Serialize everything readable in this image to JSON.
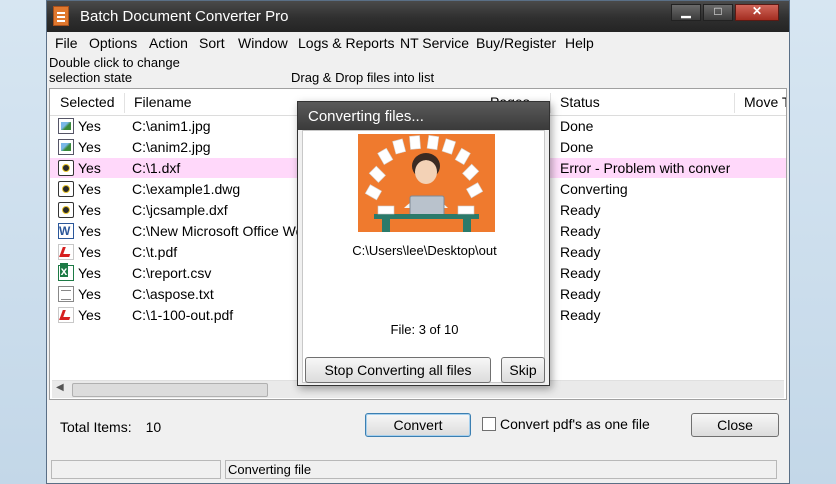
{
  "window": {
    "title": "Batch Document Converter Pro",
    "min_glyph": "▁",
    "max_glyph": "□",
    "close_glyph": "✕"
  },
  "menu": [
    "File",
    "Options",
    "Action",
    "Sort",
    "Window",
    "Logs & Reports",
    "NT Service",
    "Buy/Register",
    "Help"
  ],
  "hints": {
    "selection": [
      "Double click to change",
      "selection state"
    ],
    "drag_drop": "Drag & Drop files into list"
  },
  "table": {
    "columns": [
      "Selected",
      "Filename",
      "Pages",
      "Status",
      "Move T"
    ],
    "rows": [
      {
        "icon": "image-file-icon",
        "selected": "Yes",
        "filename": "C:\\anim1.jpg",
        "status": "Done"
      },
      {
        "icon": "image-file-icon",
        "selected": "Yes",
        "filename": "C:\\anim2.jpg",
        "status": "Done"
      },
      {
        "icon": "dxf-file-icon",
        "selected": "Yes",
        "filename": "C:\\1.dxf",
        "status": "Error - Problem with conver..."
      },
      {
        "icon": "dwg-file-icon",
        "selected": "Yes",
        "filename": "C:\\example1.dwg",
        "status": "Converting"
      },
      {
        "icon": "dxf-file-icon",
        "selected": "Yes",
        "filename": "C:\\jcsample.dxf",
        "status": "Ready"
      },
      {
        "icon": "word-file-icon",
        "selected": "Yes",
        "filename": "C:\\New Microsoft Office Word",
        "status": "Ready"
      },
      {
        "icon": "pdf-file-icon",
        "selected": "Yes",
        "filename": "C:\\t.pdf",
        "status": "Ready"
      },
      {
        "icon": "csv-file-icon",
        "selected": "Yes",
        "filename": "C:\\report.csv",
        "status": "Ready"
      },
      {
        "icon": "text-file-icon",
        "selected": "Yes",
        "filename": "C:\\aspose.txt",
        "status": "Ready"
      },
      {
        "icon": "pdf-file-icon",
        "selected": "Yes",
        "filename": "C:\\1-100-out.pdf",
        "status": "Ready"
      }
    ],
    "error_row_color": "#ffd8fa"
  },
  "footer": {
    "total_label": "Total Items:",
    "total_value": "10",
    "convert_label": "Convert",
    "checkbox_label": "Convert pdf's as one file",
    "checkbox_checked": false,
    "close_label": "Close"
  },
  "statusbar": {
    "left": "",
    "right": "Converting file"
  },
  "dialog": {
    "title": "Converting files...",
    "path": "C:\\Users\\lee\\Desktop\\out",
    "count": "File: 3 of 10",
    "stop_label": "Stop Converting all files",
    "skip_label": "Skip",
    "illustration_bg": "#ef7a2e"
  }
}
